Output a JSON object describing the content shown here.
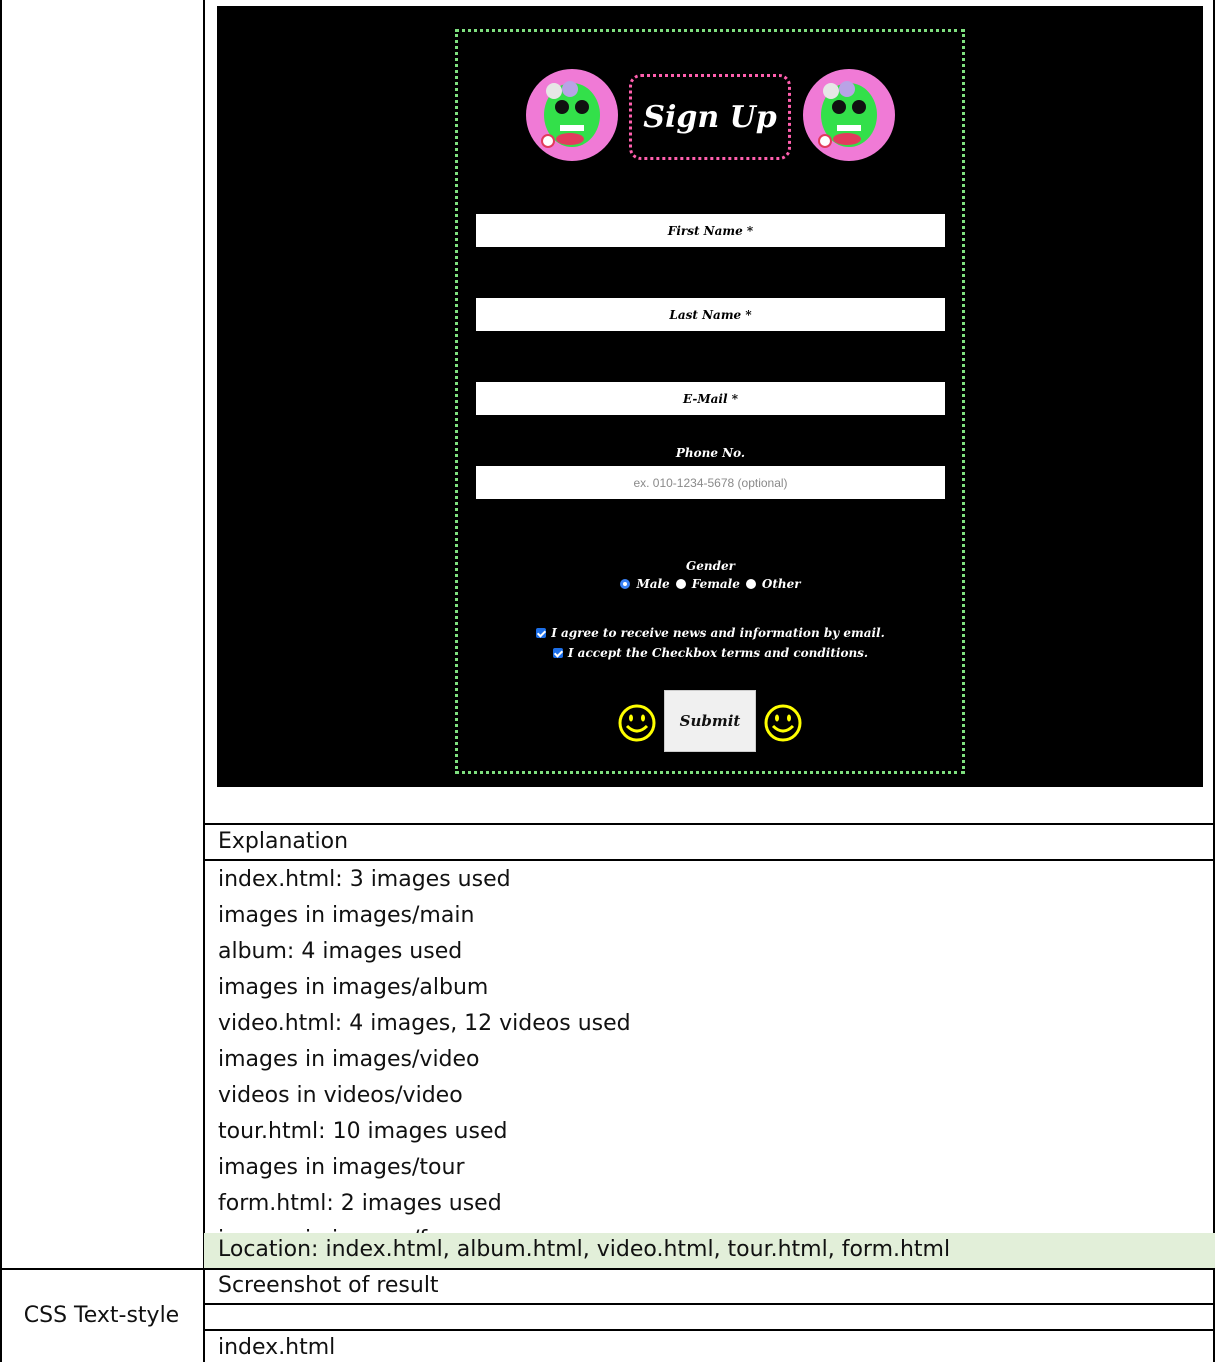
{
  "screenshot": {
    "title": "Sign Up",
    "fields": {
      "first_name": "First Name *",
      "last_name": "Last Name *",
      "email": "E-Mail *",
      "phone_label": "Phone No.",
      "phone_placeholder": "ex. 010-1234-5678 (optional)"
    },
    "gender": {
      "label": "Gender",
      "options": [
        "Male",
        "Female",
        "Other"
      ],
      "selected": "Male"
    },
    "checkboxes": [
      "I agree to receive news and information by email.",
      "I accept the Checkbox terms and conditions."
    ],
    "submit_label": "Submit",
    "colors": {
      "frame": "#7fe07f",
      "title_border": "#ff5fae",
      "avatar_bg": "#f07ad6",
      "smiley": "#ffff00"
    }
  },
  "explanation": {
    "heading": "Explanation",
    "lines": [
      "index.html: 3 images used",
      "images in images/main",
      "album: 4 images used",
      "images in images/album",
      "video.html: 4 images, 12 videos used",
      "images in images/video",
      "videos in videos/video",
      "tour.html: 10 images used",
      "images in images/tour",
      "form.html: 2 images used",
      "images in images/form"
    ],
    "location": "Location: index.html, album.html, video.html, tour.html, form.html"
  },
  "css_section": {
    "label": "CSS Text-style",
    "screenshot_heading": "Screenshot of result",
    "file": "index.html"
  }
}
